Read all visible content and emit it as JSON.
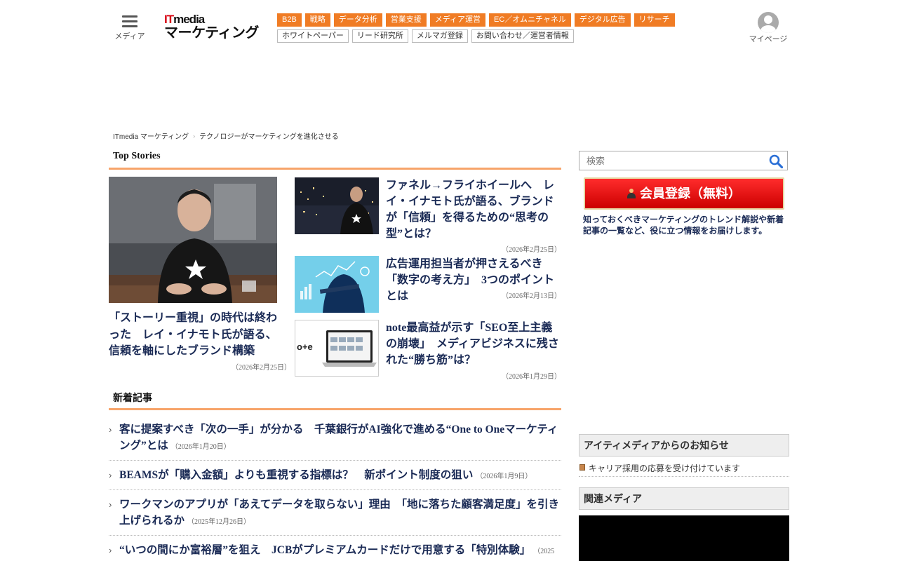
{
  "header": {
    "menu_label": "メディア",
    "logo_it": "IT",
    "logo_media": "media",
    "logo_site": "マーケティング",
    "categories": [
      "B2B",
      "戦略",
      "データ分析",
      "営業支援",
      "メディア運営",
      "EC／オムニチャネル",
      "デジタル広告",
      "リサーチ"
    ],
    "sub_links": [
      "ホワイトペーパー",
      "リード研究所",
      "メルマガ登録",
      "お問い合わせ／運営者情報"
    ],
    "mypage_label": "マイページ"
  },
  "breadcrumb": [
    "ITmedia マーケティング",
    "テクノロジーがマーケティングを進化させる"
  ],
  "top_stories": {
    "heading": "Top Stories",
    "lead": {
      "title": "「ストーリー重視」の時代は終わった　レイ・イナモト氏が語る、信頼を軸にしたブランド構築",
      "date": "（2026年2月25日）"
    },
    "items": [
      {
        "title": "ファネル→フライホイールへ　レイ・イナモト氏が語る、ブランドが「信頼」を得るための“思考の型”とは？",
        "date": "（2026年2月25日）"
      },
      {
        "title": "広告運用担当者が押さえるべき「数字の考え方」　3つのポイントとは",
        "date": "（2026年2月13日）"
      },
      {
        "title": "note最高益が示す「SEO至上主義の崩壊」　メディアビジネスに残された“勝ち筋”は？",
        "date": "（2026年1月29日）"
      }
    ]
  },
  "news": {
    "heading": "新着記事",
    "items": [
      {
        "title": "客に提案すべき「次の一手」が分かる　千葉銀行がAI強化で進める“One to Oneマーケティング”とは",
        "date": "（2026年1月20日）"
      },
      {
        "title": "BEAMSが「購入金額」よりも重視する指標は？　新ポイント制度の狙い",
        "date": "（2026年1月9日）"
      },
      {
        "title": "ワークマンのアプリが「あえてデータを取らない」理由　「地に落ちた顧客満足度」を引き上げられるか",
        "date": "（2025年12月26日）"
      },
      {
        "title": "“いつの間にか富裕層”を狙え　JCBがプレミアムカードだけで用意する「特別体験」",
        "date": "（2025"
      }
    ]
  },
  "sidebar": {
    "search_placeholder": "検索",
    "register_label": "会員登録（無料）",
    "register_desc": "知っておくべきマーケティングのトレンド解説や新着記事の一覧など、役に立つ情報をお届けします。",
    "notice_heading": "アイティメディアからのお知らせ",
    "notice_item": "キャリア採用の応募を受け付けています",
    "related_heading": "関連メディア"
  },
  "colors": {
    "accent": "#f07c24",
    "underline": "#f7a46a",
    "title": "#1a2a55",
    "register": "#dd0000"
  }
}
